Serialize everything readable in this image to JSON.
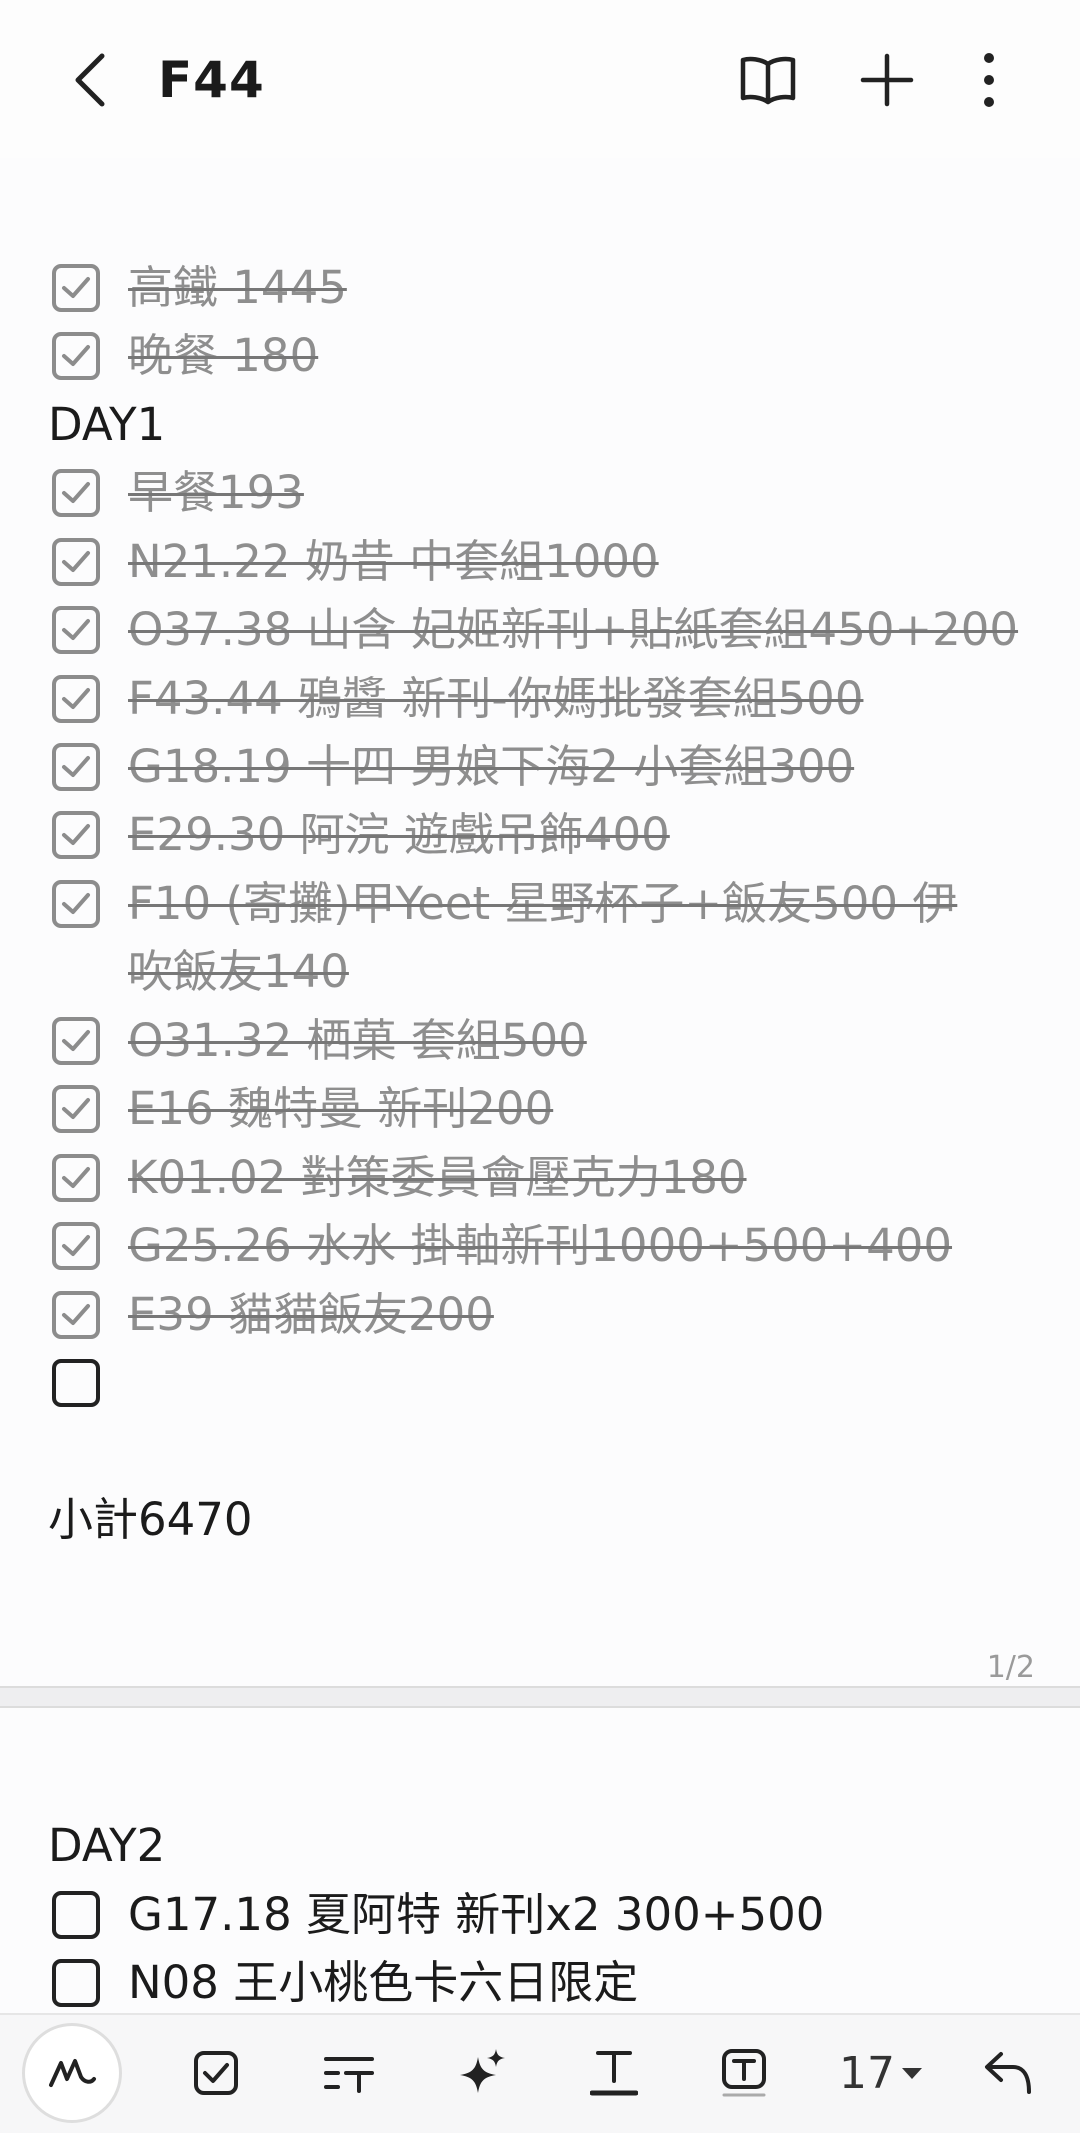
{
  "header": {
    "title": "F44",
    "back_icon": "chevron-left-icon",
    "actions": [
      "book-view-icon",
      "add-icon",
      "more-vertical-icon"
    ]
  },
  "page1": {
    "items": [
      {
        "type": "check",
        "checked": true,
        "text": "高鐵 1445"
      },
      {
        "type": "check",
        "checked": true,
        "text": "晚餐 180"
      },
      {
        "type": "text",
        "text": "DAY1"
      },
      {
        "type": "check",
        "checked": true,
        "text": "早餐193"
      },
      {
        "type": "check",
        "checked": true,
        "text": "N21.22 奶昔 中套組1000"
      },
      {
        "type": "check",
        "checked": true,
        "text": "O37.38 山含 妃姬新刊+貼紙套組450+200"
      },
      {
        "type": "check",
        "checked": true,
        "text": "F43.44 鴉醬 新刊-你媽批發套組500"
      },
      {
        "type": "check",
        "checked": true,
        "text": "G18.19 十四 男娘下海2 小套組300"
      },
      {
        "type": "check",
        "checked": true,
        "text": "E29.30 阿浣 遊戲吊飾400"
      },
      {
        "type": "check",
        "checked": true,
        "text": "F10 (寄攤)甲Yeet 星野杯子+飯友500 伊",
        "text2": "吹飯友140"
      },
      {
        "type": "check",
        "checked": true,
        "text": "O31.32 栖菓 套組500"
      },
      {
        "type": "check",
        "checked": true,
        "text": "E16 魏特曼 新刊200"
      },
      {
        "type": "check",
        "checked": true,
        "text": "K01.02 對策委員會壓克力180"
      },
      {
        "type": "check",
        "checked": true,
        "text": "G25.26 水水 掛軸新刊1000+500+400"
      },
      {
        "type": "check",
        "checked": true,
        "text": "E39 貓貓飯友200"
      },
      {
        "type": "check",
        "checked": false,
        "text": ""
      },
      {
        "type": "blank",
        "text": ""
      },
      {
        "type": "text",
        "text": "小計6470"
      }
    ],
    "page_indicator": "1/2"
  },
  "page2": {
    "items": [
      {
        "type": "text",
        "text": "DAY2"
      },
      {
        "type": "check",
        "checked": false,
        "text": "G17.18 夏阿特 新刊x2 300+500"
      },
      {
        "type": "check",
        "checked": false,
        "text": "N08 王小桃色卡六日限定"
      }
    ]
  },
  "toolbar": {
    "tools": [
      "pen-icon",
      "checkbox-icon",
      "text-style-icon",
      "ai-sparkle-icon",
      "text-format-icon",
      "text-box-icon"
    ],
    "font_size": "17",
    "undo_icon": "undo-icon"
  },
  "colors": {
    "checked_text": "#8e8e8e",
    "text": "#1b1b1b",
    "background": "#fcfcfd"
  }
}
